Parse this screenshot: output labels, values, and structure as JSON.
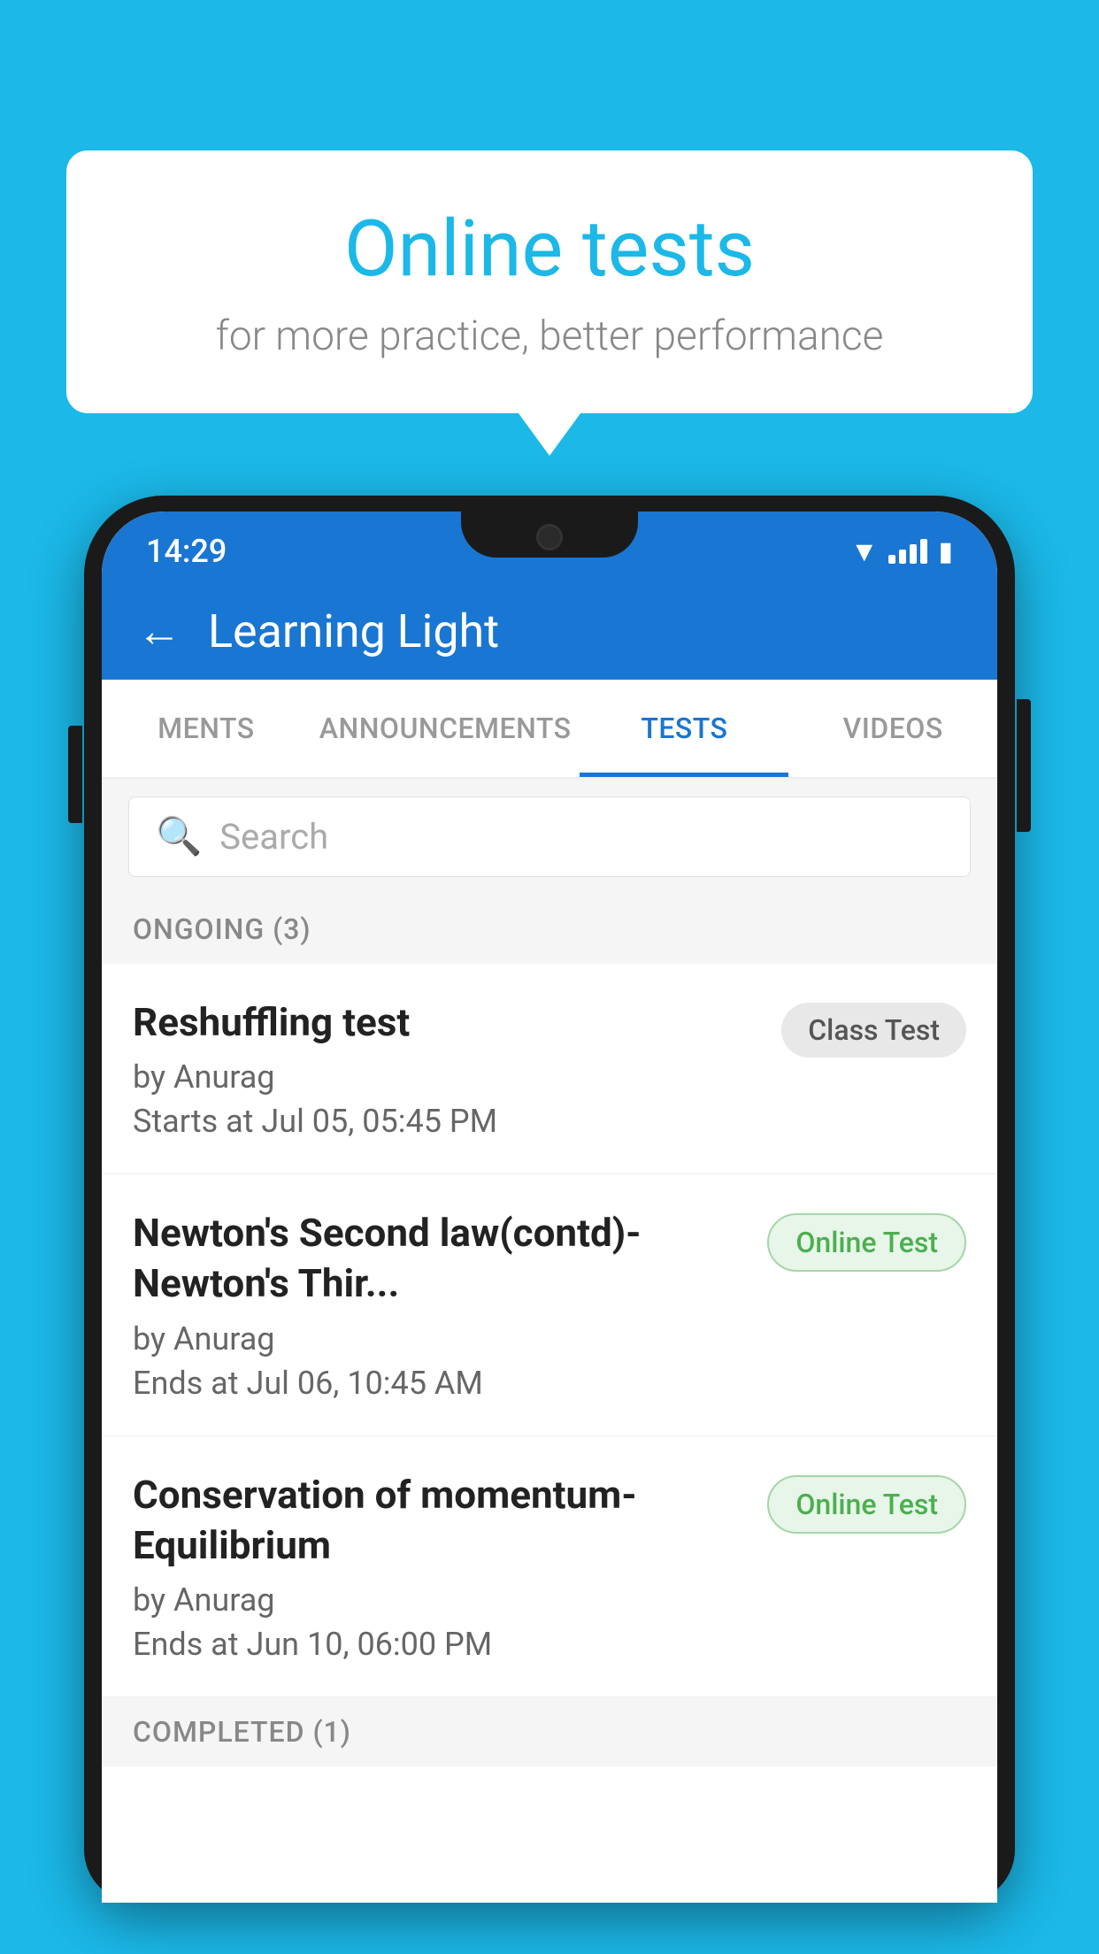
{
  "background_color": "#1BB8E8",
  "bubble": {
    "title": "Online tests",
    "subtitle": "for more practice, better performance"
  },
  "status_bar": {
    "time": "14:29",
    "wifi": "▾",
    "battery": "▮"
  },
  "app_bar": {
    "title": "Learning Light",
    "back_label": "←"
  },
  "tabs": [
    {
      "label": "MENTS",
      "active": false
    },
    {
      "label": "ANNOUNCEMENTS",
      "active": false
    },
    {
      "label": "TESTS",
      "active": true
    },
    {
      "label": "VIDEOS",
      "active": false
    }
  ],
  "search": {
    "placeholder": "Search"
  },
  "ongoing_section": {
    "label": "ONGOING (3)"
  },
  "tests": [
    {
      "name": "Reshuffling test",
      "author": "by Anurag",
      "time_label": "Starts at",
      "time": "Jul 05, 05:45 PM",
      "badge": "Class Test",
      "badge_type": "class"
    },
    {
      "name": "Newton's Second law(contd)-Newton's Thir...",
      "author": "by Anurag",
      "time_label": "Ends at",
      "time": "Jul 06, 10:45 AM",
      "badge": "Online Test",
      "badge_type": "online"
    },
    {
      "name": "Conservation of momentum-Equilibrium",
      "author": "by Anurag",
      "time_label": "Ends at",
      "time": "Jun 10, 06:00 PM",
      "badge": "Online Test",
      "badge_type": "online"
    }
  ],
  "completed_section": {
    "label": "COMPLETED (1)"
  }
}
